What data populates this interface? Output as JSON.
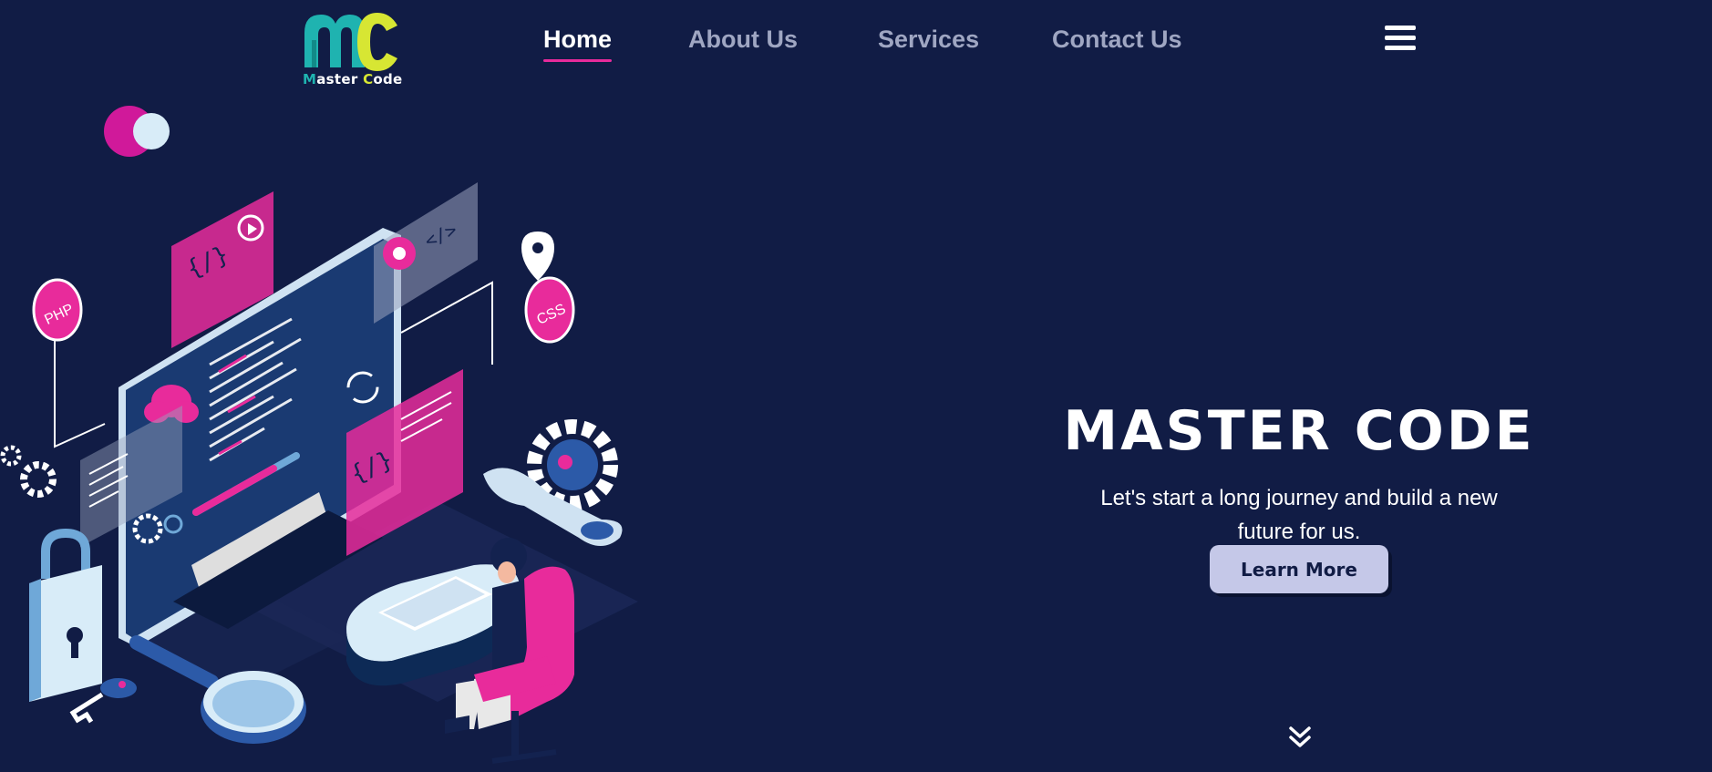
{
  "brand": {
    "logo_part1": "Master",
    "logo_part2": "Code",
    "colors": {
      "teal": "#1fb3b0",
      "lime": "#d7e633",
      "pink": "#e82b9b",
      "background": "#111c45"
    }
  },
  "nav": {
    "items": [
      {
        "label": "Home",
        "active": true
      },
      {
        "label": "About Us",
        "active": false
      },
      {
        "label": "Services",
        "active": false
      },
      {
        "label": "Contact Us",
        "active": false
      }
    ],
    "menu_icon": "hamburger-icon"
  },
  "hero": {
    "title": "MASTER CODE",
    "subtitle": "Let's start a long journey and build a new future for us.",
    "cta_label": "Learn More",
    "scroll_icon": "double-chevron-down-icon"
  },
  "illustration": {
    "badges": [
      "PHP",
      "CSS"
    ],
    "code_tags": [
      "</>",
      "{/}"
    ]
  }
}
